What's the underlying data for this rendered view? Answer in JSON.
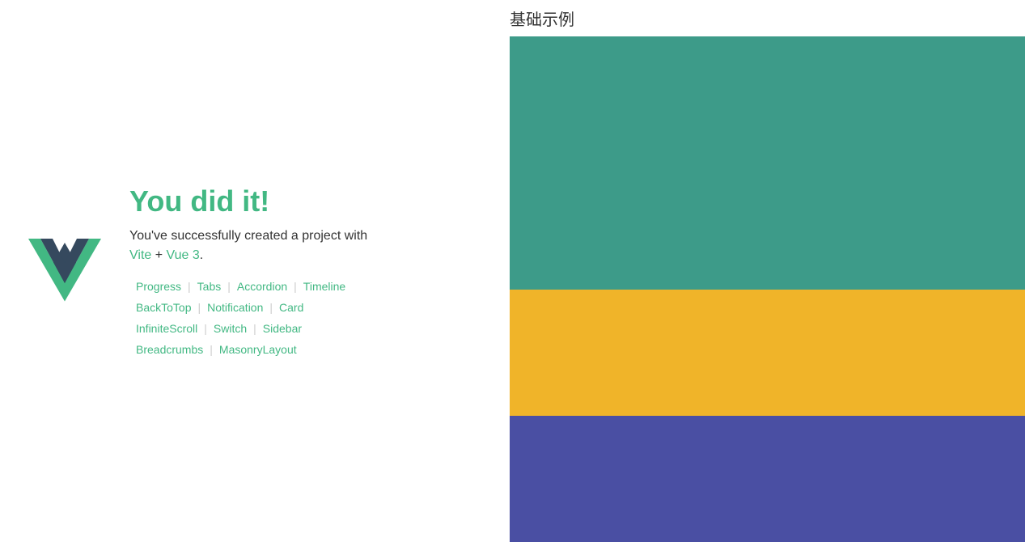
{
  "left": {
    "headline": "You did it!",
    "subtitle_before": "You've successfully created a project with",
    "subtitle_link1": "Vite",
    "subtitle_plus": " + ",
    "subtitle_link2": "Vue 3",
    "subtitle_dot": ".",
    "links": [
      [
        {
          "label": "Progress",
          "sep": true
        },
        {
          "label": "Tabs",
          "sep": true
        },
        {
          "label": "Accordion",
          "sep": true
        },
        {
          "label": "Timeline",
          "sep": false
        }
      ],
      [
        {
          "label": "BackToTop",
          "sep": true
        },
        {
          "label": "Notification",
          "sep": true
        },
        {
          "label": "Card",
          "sep": false
        }
      ],
      [
        {
          "label": "InfiniteScroll",
          "sep": true
        },
        {
          "label": "Switch",
          "sep": true
        },
        {
          "label": "Sidebar",
          "sep": false
        }
      ],
      [
        {
          "label": "Breadcrumbs",
          "sep": true
        },
        {
          "label": "MasonryLayout",
          "sep": false
        }
      ]
    ]
  },
  "right": {
    "title": "基础示例",
    "colors": {
      "teal": "#3d9b89",
      "yellow": "#f0b429",
      "purple": "#4a4fa3"
    }
  }
}
